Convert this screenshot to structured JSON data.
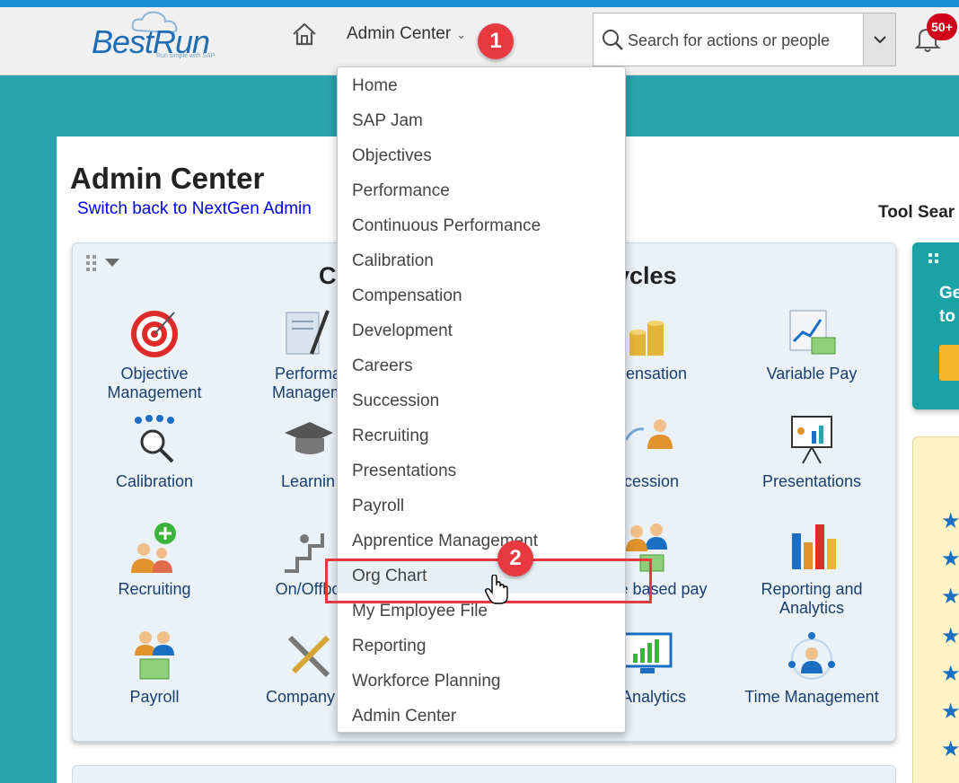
{
  "header": {
    "logo_text": "BestRun",
    "logo_subtext": "Run simple with SAP",
    "home_icon": "home-icon",
    "nav_label": "Admin Center",
    "search_placeholder": "Search for actions or people",
    "notification_badge": "50+"
  },
  "page": {
    "title": "Admin Center",
    "switch_link": "Switch back to NextGen Admin",
    "tool_search_label": "Tool Sear"
  },
  "tile": {
    "title_left": "C",
    "title_right": "ycles",
    "apps": [
      {
        "label": "Objective Management",
        "icon": "target-icon"
      },
      {
        "label": "Performa Managem",
        "icon": "document-pen-icon"
      },
      {
        "label": "npensation",
        "icon": "coins-icon"
      },
      {
        "label": "Variable Pay",
        "icon": "chart-money-icon"
      },
      {
        "label": "Calibration",
        "icon": "magnifier-people-icon"
      },
      {
        "label": "Learnin",
        "icon": "graduation-cap-icon"
      },
      {
        "label": "ccession",
        "icon": "succession-people-icon"
      },
      {
        "label": "Presentations",
        "icon": "presentation-board-icon"
      },
      {
        "label": "Recruiting",
        "icon": "add-people-icon"
      },
      {
        "label": "On/Offbo",
        "icon": "stairs-people-icon"
      },
      {
        "label": "Scale based pay",
        "icon": "people-money-icon"
      },
      {
        "label": "Reporting and Analytics",
        "icon": "bar-chart-icon"
      },
      {
        "label": "Payroll",
        "icon": "people-cash-icon"
      },
      {
        "label": "Company S",
        "icon": "tools-icon"
      },
      {
        "label": "e Analytics",
        "icon": "monitor-chart-icon"
      },
      {
        "label": "Time Management",
        "icon": "people-network-icon"
      }
    ]
  },
  "right_panel": {
    "text": "Ge to"
  },
  "menu": {
    "items": [
      "Home",
      "SAP Jam",
      "Objectives",
      "Performance",
      "Continuous Performance",
      "Calibration",
      "Compensation",
      "Development",
      "Careers",
      "Succession",
      "Recruiting",
      "Presentations",
      "Payroll",
      "Apprentice Management",
      "Org Chart",
      "My Employee File",
      "Reporting",
      "Workforce Planning",
      "Admin Center"
    ],
    "highlighted": "Org Chart"
  },
  "annotations": {
    "step1": "1",
    "step2": "2"
  },
  "colors": {
    "accent": "#1b8fd6",
    "teal_bg": "#2aa3ad",
    "annotation": "#e8393f",
    "link": "#0000ee"
  }
}
